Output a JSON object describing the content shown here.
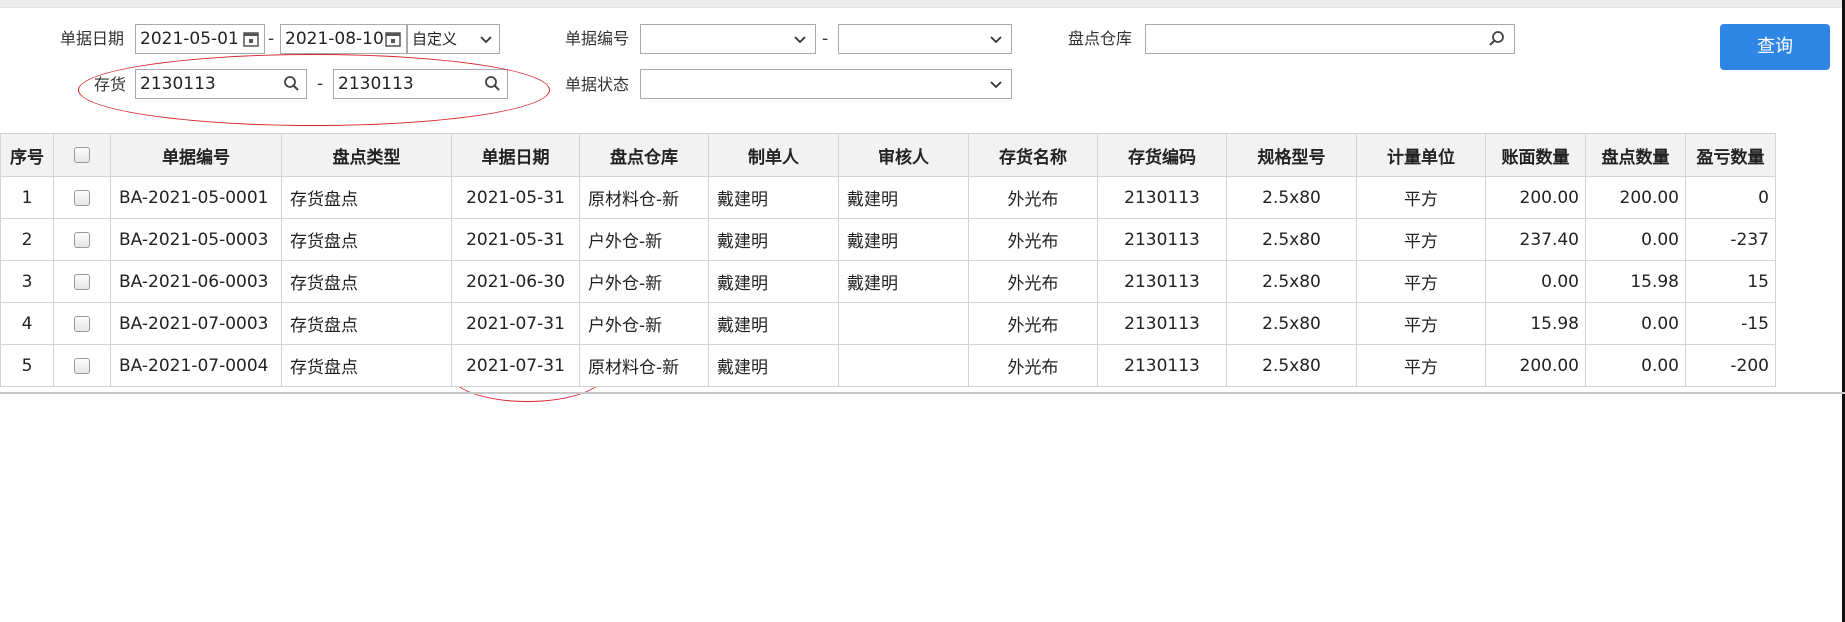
{
  "filters": {
    "date_label": "单据日期",
    "date_from": "2021-05-01",
    "date_to": "2021-08-10",
    "date_range_type": "自定义",
    "doc_no_label": "单据编号",
    "doc_no_from": "",
    "doc_no_to": "",
    "warehouse_label": "盘点仓库",
    "warehouse_value": "",
    "inventory_label": "存货",
    "inventory_from": "2130113",
    "inventory_to": "2130113",
    "status_label": "单据状态",
    "status_value": "",
    "range_dash": "-",
    "query_button": "查询"
  },
  "table": {
    "headers": [
      "序号",
      "",
      "单据编号",
      "盘点类型",
      "单据日期",
      "盘点仓库",
      "制单人",
      "审核人",
      "存货名称",
      "存货编码",
      "规格型号",
      "计量单位",
      "账面数量",
      "盘点数量",
      "盈亏数量"
    ],
    "rows": [
      {
        "seq": "1",
        "doc_no": "BA-2021-05-0001",
        "type": "存货盘点",
        "date": "2021-05-31",
        "warehouse": "原材料仓-新",
        "creator": "戴建明",
        "auditor": "戴建明",
        "item_name": "外光布",
        "item_code": "2130113",
        "spec": "2.5x80",
        "unit": "平方",
        "book_qty": "200.00",
        "count_qty": "200.00",
        "diff_qty": "0",
        "diff_negative": false
      },
      {
        "seq": "2",
        "doc_no": "BA-2021-05-0003",
        "type": "存货盘点",
        "date": "2021-05-31",
        "warehouse": "户外仓-新",
        "creator": "戴建明",
        "auditor": "戴建明",
        "item_name": "外光布",
        "item_code": "2130113",
        "spec": "2.5x80",
        "unit": "平方",
        "book_qty": "237.40",
        "count_qty": "0.00",
        "diff_qty": "-237",
        "diff_negative": true
      },
      {
        "seq": "3",
        "doc_no": "BA-2021-06-0003",
        "type": "存货盘点",
        "date": "2021-06-30",
        "warehouse": "户外仓-新",
        "creator": "戴建明",
        "auditor": "戴建明",
        "item_name": "外光布",
        "item_code": "2130113",
        "spec": "2.5x80",
        "unit": "平方",
        "book_qty": "0.00",
        "count_qty": "15.98",
        "diff_qty": "15",
        "diff_negative": false
      },
      {
        "seq": "4",
        "doc_no": "BA-2021-07-0003",
        "type": "存货盘点",
        "date": "2021-07-31",
        "warehouse": "户外仓-新",
        "creator": "戴建明",
        "auditor": "",
        "item_name": "外光布",
        "item_code": "2130113",
        "spec": "2.5x80",
        "unit": "平方",
        "book_qty": "15.98",
        "count_qty": "0.00",
        "diff_qty": "-15",
        "diff_negative": true
      },
      {
        "seq": "5",
        "doc_no": "BA-2021-07-0004",
        "type": "存货盘点",
        "date": "2021-07-31",
        "warehouse": "原材料仓-新",
        "creator": "戴建明",
        "auditor": "",
        "item_name": "外光布",
        "item_code": "2130113",
        "spec": "2.5x80",
        "unit": "平方",
        "book_qty": "200.00",
        "count_qty": "0.00",
        "diff_qty": "-200",
        "diff_negative": true
      }
    ]
  },
  "colors": {
    "accent": "#2f86e4",
    "negative": "#e0201f",
    "annotation": "#d9262c",
    "header_bg": "#f2f2f2"
  },
  "icons": [
    "calendar-icon",
    "chevron-down-icon",
    "search-icon"
  ]
}
